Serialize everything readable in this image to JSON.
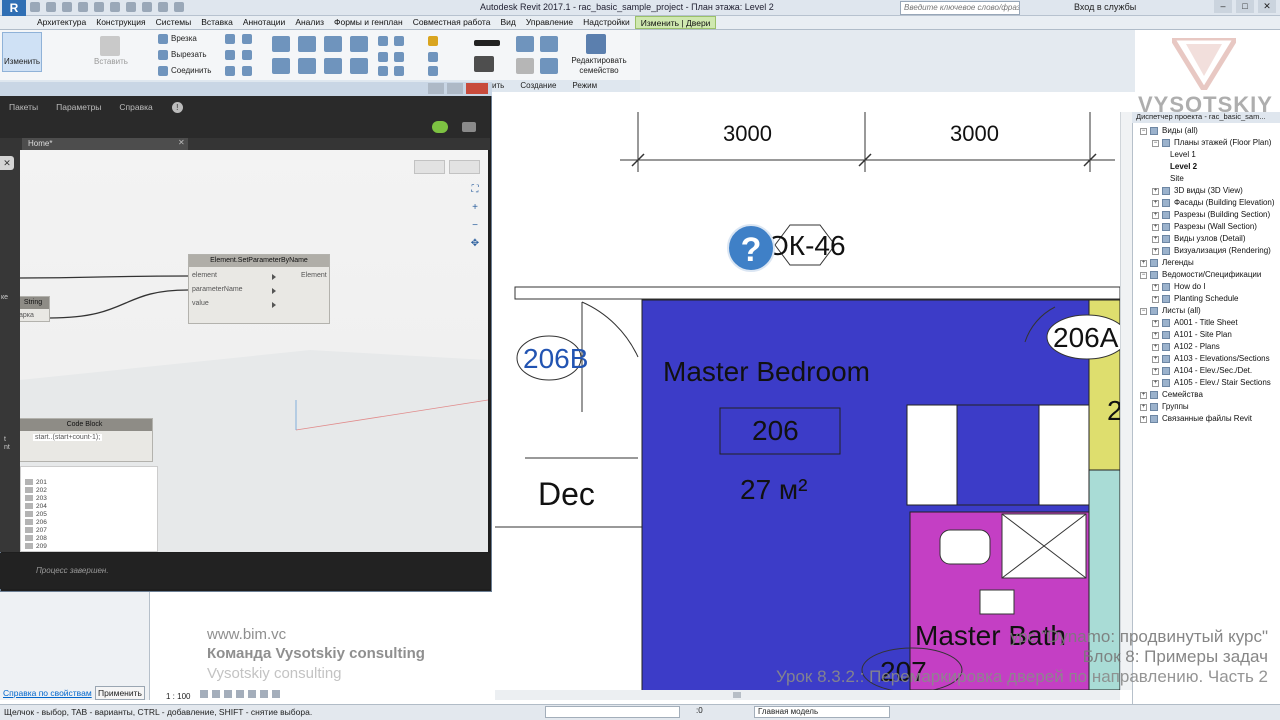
{
  "app": {
    "title": "Autodesk Revit 2017.1 -   rac_basic_sample_project - План этажа: Level 2",
    "search_placeholder": "Введите ключевое слово/фразу",
    "login": "Вход в службы",
    "logo_letter": "R"
  },
  "menu": [
    "Архитектура",
    "Конструкция",
    "Системы",
    "Вставка",
    "Аннотации",
    "Анализ",
    "Формы и генплан",
    "Совместная работа",
    "Вид",
    "Управление",
    "Надстройки",
    "Изменить | Двери"
  ],
  "ribbon": {
    "modify_label": "Изменить",
    "paste_label": "Вставить",
    "cut_label": "Врезка",
    "cutout_label": "Вырезать",
    "join_label": "Соединить",
    "edit_family_label": "Редактировать семейство",
    "panels": [
      "Создание",
      "Режим"
    ],
    "panel_partial": "ить"
  },
  "dynamo": {
    "menu": [
      "Пакеты",
      "Параметры",
      "Справка"
    ],
    "tab": "Home*",
    "status": "Процесс завершен.",
    "nodes": {
      "setparam": {
        "title": "Element.SetParameterByName",
        "inputs": [
          "element",
          "parameterName",
          "value"
        ],
        "output": "Element"
      },
      "string": {
        "title": "String",
        "value": "арка"
      },
      "codeblock": {
        "title": "Code Block",
        "code": "start..(start+count-1);"
      }
    },
    "watch_values": [
      "201",
      "202",
      "203",
      "204",
      "205",
      "206",
      "207",
      "208",
      "209"
    ],
    "left_fragments": {
      "a": "ке",
      "b": "t",
      "c": "nt"
    }
  },
  "drawing": {
    "dims": [
      "3000",
      "3000"
    ],
    "tag_window": "ОК-46",
    "door_tags": [
      "206B",
      "206A"
    ],
    "room_name": "Master Bedroom",
    "room_number": "206",
    "room_area": "27 м²",
    "room2_name": "Master Bath",
    "room2_number": "207",
    "room3_name": "Dec",
    "tag_partial": "2"
  },
  "browser": {
    "title": "Диспетчер проекта - rac_basic_sam...",
    "items": [
      {
        "label": "Виды (all)",
        "level": 0,
        "expanded": true
      },
      {
        "label": "Планы этажей (Floor Plan)",
        "level": 1,
        "expanded": true
      },
      {
        "label": "Level 1",
        "level": 2
      },
      {
        "label": "Level 2",
        "level": 2,
        "bold": true
      },
      {
        "label": "Site",
        "level": 2
      },
      {
        "label": "3D виды (3D View)",
        "level": 1
      },
      {
        "label": "Фасады (Building Elevation)",
        "level": 1
      },
      {
        "label": "Разрезы (Building Section)",
        "level": 1
      },
      {
        "label": "Разрезы (Wall Section)",
        "level": 1
      },
      {
        "label": "Виды узлов (Detail)",
        "level": 1
      },
      {
        "label": "Визуализация (Rendering)",
        "level": 1
      },
      {
        "label": "Легенды",
        "level": 0
      },
      {
        "label": "Ведомости/Спецификации",
        "level": 0,
        "expanded": true
      },
      {
        "label": "How do I",
        "level": 1
      },
      {
        "label": "Planting Schedule",
        "level": 1
      },
      {
        "label": "Листы (all)",
        "level": 0,
        "expanded": true
      },
      {
        "label": "A001 - Title Sheet",
        "level": 1
      },
      {
        "label": "A101 - Site Plan",
        "level": 1
      },
      {
        "label": "A102 - Plans",
        "level": 1
      },
      {
        "label": "A103 - Elevations/Sections",
        "level": 1
      },
      {
        "label": "A104 - Elev./Sec./Det.",
        "level": 1
      },
      {
        "label": "A105 - Elev./ Stair Sections",
        "level": 1
      },
      {
        "label": "Семейства",
        "level": 0
      },
      {
        "label": "Группы",
        "level": 0
      },
      {
        "label": "Связанные файлы Revit",
        "level": 0
      }
    ]
  },
  "properties": {
    "link": "Справка по свойствам",
    "apply": "Применить"
  },
  "view": {
    "scale": "1 : 100"
  },
  "status": {
    "text": "Щелчок - выбор, TAB - варианты, CTRL - добавление, SHIFT - снятие выбора.",
    "count": ":0",
    "model": "Главная модель"
  },
  "watermark": {
    "url": "www.bim.vc",
    "team": "Команда Vysotskiy consulting",
    "consult": "Vysotskiy consulting",
    "brand": "VYSOTSKIY",
    "course_1": "урс \"Dynamo: продвинутый курс\"",
    "course_2": "Блок 8: Примеры задач",
    "course_3": "Урок 8.3.2.: Перемаркировка дверей по направлению. Часть 2"
  }
}
